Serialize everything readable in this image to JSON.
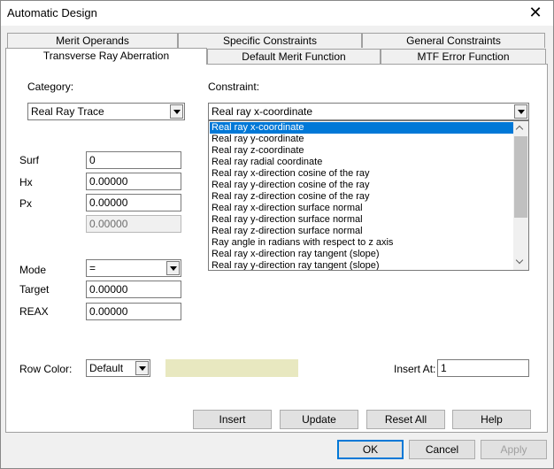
{
  "window": {
    "title": "Automatic Design"
  },
  "tabs": {
    "row_back": [
      "Merit Operands",
      "Specific Constraints",
      "General Constraints"
    ],
    "row_front": [
      "Transverse Ray Aberration",
      "Default Merit Function",
      "MTF Error Function"
    ],
    "active": "Transverse Ray Aberration"
  },
  "form": {
    "category_label": "Category:",
    "category_value": "Real Ray Trace",
    "constraint_label": "Constraint:",
    "constraint_value": "Real ray x-coordinate",
    "surf_label": "Surf",
    "surf_value": "0",
    "hx_label": "Hx",
    "hx_value": "0.00000",
    "px_label": "Px",
    "px_value": "0.00000",
    "extra_value": "0.00000",
    "mode_label": "Mode",
    "mode_value": "=",
    "target_label": "Target",
    "target_value": "0.00000",
    "reax_label": "REAX",
    "reax_value": "0.00000",
    "row_color_label": "Row Color:",
    "row_color_value": "Default",
    "row_color_swatch": "#e8e8c0",
    "insert_at_label": "Insert At:",
    "insert_at_value": "1"
  },
  "constraint_options": [
    "Real ray x-coordinate",
    "Real ray y-coordinate",
    "Real ray z-coordinate",
    "Real ray radial coordinate",
    "Real ray x-direction cosine of the ray",
    "Real ray y-direction cosine of the ray",
    "Real ray z-direction cosine of the ray",
    "Real ray x-direction surface normal",
    "Real ray y-direction surface normal",
    "Real ray z-direction surface normal",
    "Ray angle in radians with respect to z axis",
    "Real ray x-direction ray tangent (slope)",
    "Real ray y-direction ray tangent (slope)"
  ],
  "buttons": {
    "insert": "Insert",
    "update": "Update",
    "reset_all": "Reset All",
    "help": "Help",
    "ok": "OK",
    "cancel": "Cancel",
    "apply": "Apply"
  },
  "colors": {
    "selection": "#0078d7",
    "focus_border": "#0078d7"
  }
}
